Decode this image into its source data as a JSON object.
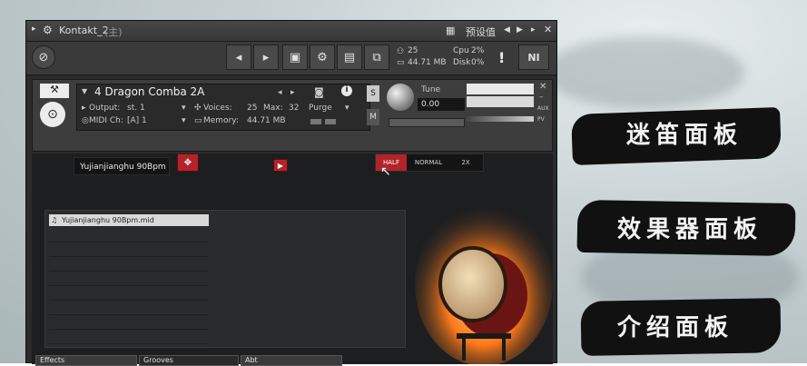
{
  "window": {
    "title": "Kontakt_2",
    "title_suffix": "(主)",
    "preset_label": "预设值"
  },
  "toolbar": {
    "stats": {
      "voices": "25",
      "memory": "44.71 MB",
      "cpu_label": "Cpu",
      "cpu_value": "2%",
      "disk_label": "Disk",
      "disk_value": "0%"
    },
    "ni_label": "NI"
  },
  "instrument": {
    "name": "4 Dragon Comba 2A",
    "output_label": "Output:",
    "output_value": "st. 1",
    "voices_label": "Voices:",
    "voices_value": "25",
    "max_label": "Max:",
    "max_value": "32",
    "purge_label": "Purge",
    "midi_label": "MIDI Ch:",
    "midi_value": "[A] 1",
    "memory_label": "Memory:",
    "memory_value": "44.71 MB",
    "s_label": "S",
    "m_label": "M",
    "tune_label": "Tune",
    "tune_value": "0.00",
    "aux_label": "AUX",
    "pv_label": "PV"
  },
  "panel": {
    "preset_name": "Yujianjianghu 90Bpm",
    "modes": [
      "HALF",
      "NORMAL",
      "2X"
    ],
    "file_name": "Yujianjianghu 90Bpm.mid"
  },
  "tabs": [
    "Effects",
    "Grooves",
    "Abt"
  ],
  "side_labels": [
    "迷笛面板",
    "效果器面板",
    "介绍面板"
  ],
  "colors": {
    "accent_red": "#b3232a",
    "window_bg": "#2b2b2b"
  }
}
